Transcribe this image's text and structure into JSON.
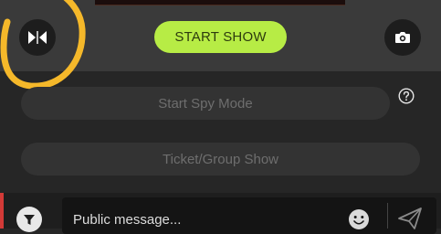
{
  "controls": {
    "start_show_label": "START SHOW"
  },
  "options": {
    "spy_mode_label": "Start Spy Mode",
    "ticket_show_label": "Ticket/Group Show"
  },
  "chat": {
    "placeholder": "Public message..."
  },
  "icons": {
    "flip": "flip-camera-icon",
    "camera": "camera-switch-icon",
    "help": "help-icon",
    "filter": "filter-icon",
    "emoji": "emoji-icon",
    "send": "send-icon"
  },
  "colors": {
    "start_show_bg": "#b7ec45",
    "highlight_annotation": "#f5b82a",
    "accent_red": "#d23a37"
  }
}
